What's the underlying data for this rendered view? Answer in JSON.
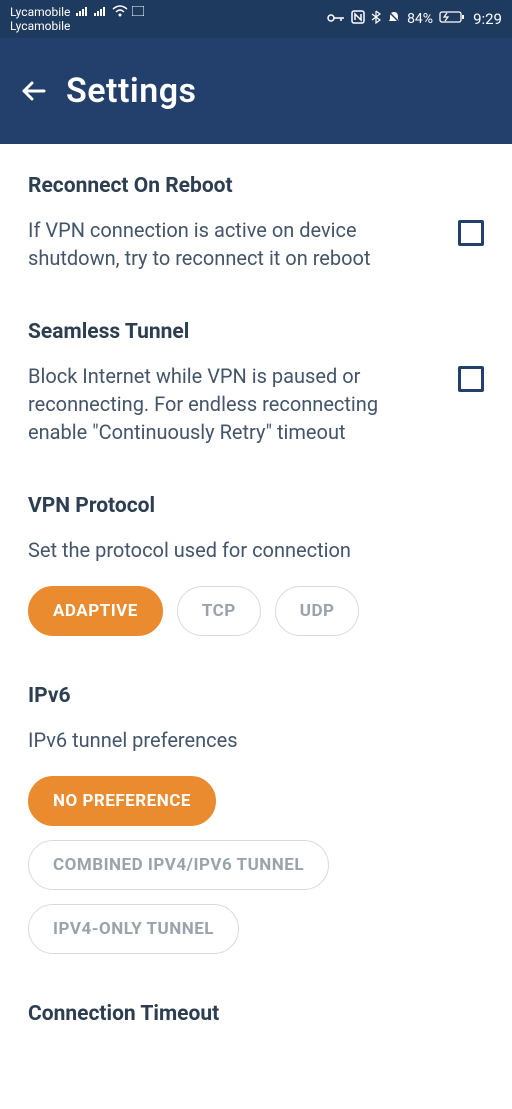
{
  "status": {
    "carrier1": "Lycamobile",
    "carrier2": "Lycamobile",
    "battery_pct": "84%",
    "time": "9:29"
  },
  "header": {
    "title": "Settings"
  },
  "sections": {
    "reconnect": {
      "title": "Reconnect On Reboot",
      "desc": "If VPN connection is active on device shutdown, try to reconnect it on reboot",
      "checked": false
    },
    "seamless": {
      "title": "Seamless Tunnel",
      "desc": "Block Internet while VPN is paused or reconnecting. For endless reconnecting enable \"Continuously Retry\" timeout",
      "checked": false
    },
    "protocol": {
      "title": "VPN Protocol",
      "desc": "Set the protocol used for connection",
      "options": {
        "adaptive": "ADAPTIVE",
        "tcp": "TCP",
        "udp": "UDP"
      },
      "selected": "adaptive"
    },
    "ipv6": {
      "title": "IPv6",
      "desc": "IPv6 tunnel preferences",
      "options": {
        "nopref": "NO PREFERENCE",
        "combined": "COMBINED IPV4/IPV6 TUNNEL",
        "ipv4only": "IPV4-ONLY TUNNEL"
      },
      "selected": "nopref"
    },
    "timeout": {
      "title": "Connection Timeout"
    }
  }
}
